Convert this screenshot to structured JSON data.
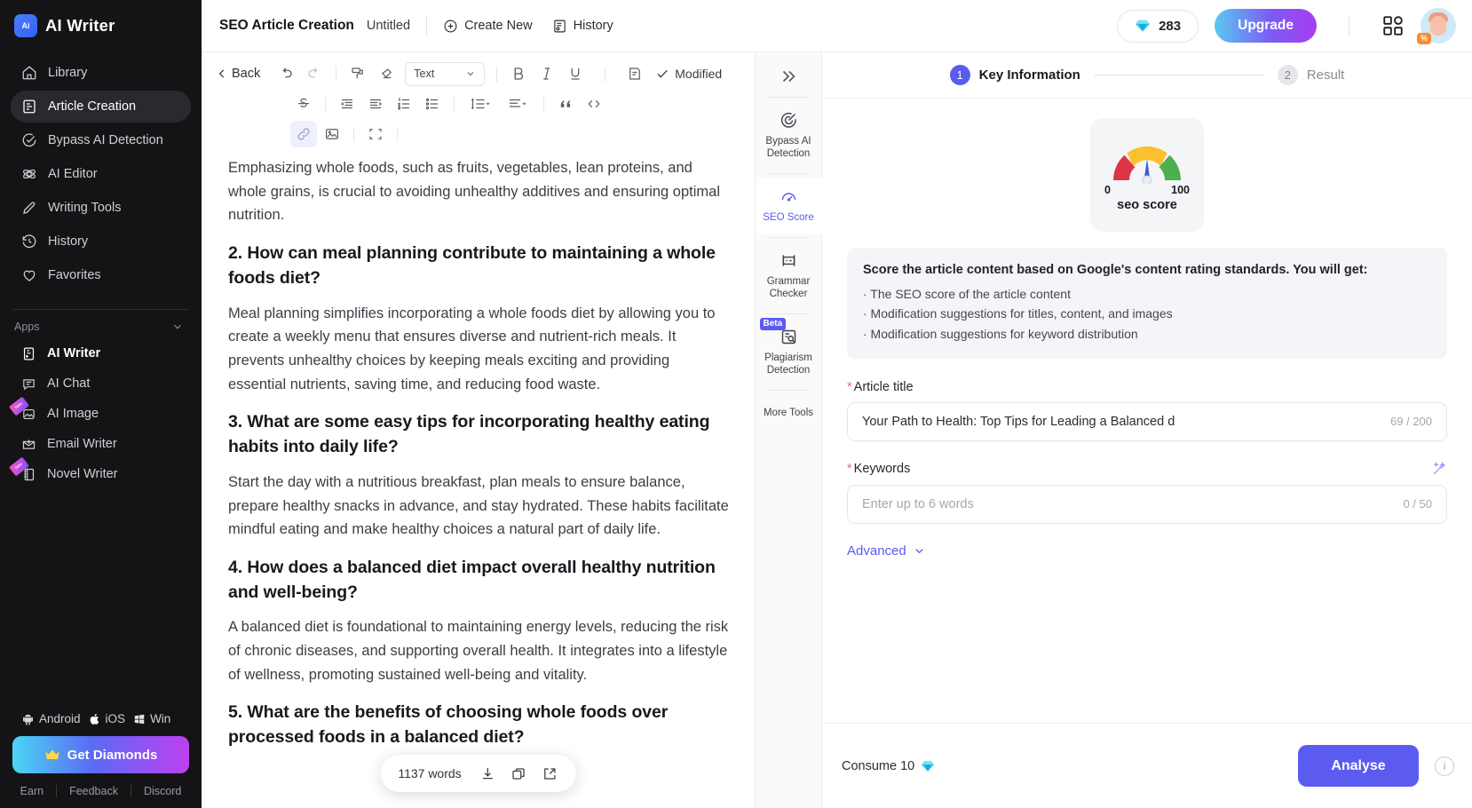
{
  "brand": {
    "name": "AI Writer",
    "logo_text": "Ai"
  },
  "sidebar": {
    "nav": [
      {
        "label": "Library",
        "icon": "home-icon"
      },
      {
        "label": "Article Creation",
        "icon": "document-icon"
      },
      {
        "label": "Bypass AI Detection",
        "icon": "check-circle-icon"
      },
      {
        "label": "AI Editor",
        "icon": "atom-icon"
      },
      {
        "label": "Writing Tools",
        "icon": "pencil-icon"
      },
      {
        "label": "History",
        "icon": "clock-icon"
      },
      {
        "label": "Favorites",
        "icon": "heart-icon"
      }
    ],
    "apps_header": "Apps",
    "apps": [
      {
        "label": "AI Writer",
        "icon": "book-icon",
        "ribbon": ""
      },
      {
        "label": "AI Chat",
        "icon": "chat-icon",
        "ribbon": ""
      },
      {
        "label": "AI Image",
        "icon": "image-icon",
        "ribbon": "New"
      },
      {
        "label": "Email Writer",
        "icon": "mail-icon",
        "ribbon": ""
      },
      {
        "label": "Novel Writer",
        "icon": "notebook-icon",
        "ribbon": "New"
      }
    ],
    "platforms": [
      "Android",
      "iOS",
      "Win"
    ],
    "get_diamonds": "Get Diamonds",
    "links": [
      "Earn",
      "Feedback",
      "Discord"
    ]
  },
  "topbar": {
    "title": "SEO Article Creation",
    "doc_name": "Untitled",
    "create_new": "Create New",
    "history": "History",
    "credits": "283",
    "upgrade": "Upgrade"
  },
  "editor": {
    "back": "Back",
    "style_select": "Text",
    "status": "Modified",
    "word_count": "1137 words",
    "blocks": [
      {
        "type": "p",
        "text": "Emphasizing whole foods, such as fruits, vegetables, lean proteins, and whole grains, is crucial to avoiding unhealthy additives and ensuring optimal nutrition."
      },
      {
        "type": "h3",
        "text": "2. How can meal planning contribute to maintaining a whole foods diet?"
      },
      {
        "type": "p",
        "text": "Meal planning simplifies incorporating a whole foods diet by allowing you to create a weekly menu that ensures diverse and nutrient-rich meals. It prevents unhealthy choices by keeping meals exciting and providing essential nutrients, saving time, and reducing food waste."
      },
      {
        "type": "h3",
        "text": "3. What are some easy tips for incorporating healthy eating habits into daily life?"
      },
      {
        "type": "p",
        "text": "Start the day with a nutritious breakfast, plan meals to ensure balance, prepare healthy snacks in advance, and stay hydrated. These habits facilitate mindful eating and make healthy choices a natural part of daily life."
      },
      {
        "type": "h3",
        "text": "4. How does a balanced diet impact overall healthy nutrition and well-being?"
      },
      {
        "type": "p",
        "text": "A balanced diet is foundational to maintaining energy levels, reducing the risk of chronic diseases, and supporting overall health. It integrates into a lifestyle of wellness, promoting sustained well-being and vitality."
      },
      {
        "type": "h3",
        "text": "5. What are the benefits of choosing whole foods over processed foods in a balanced diet?"
      }
    ]
  },
  "tools": [
    {
      "label": "Bypass AI Detection",
      "icon": "target-icon",
      "badge": ""
    },
    {
      "label": "SEO Score",
      "icon": "gauge-icon",
      "badge": ""
    },
    {
      "label": "Grammar Checker",
      "icon": "grammar-icon",
      "badge": ""
    },
    {
      "label": "Plagiarism Detection",
      "icon": "plagiarism-icon",
      "badge": "Beta"
    },
    {
      "label": "More Tools",
      "icon": "",
      "badge": ""
    }
  ],
  "panel": {
    "steps": [
      {
        "num": "1",
        "label": "Key Information"
      },
      {
        "num": "2",
        "label": "Result"
      }
    ],
    "gauge": {
      "min": "0",
      "max": "100",
      "caption": "seo score"
    },
    "info": {
      "heading": "Score the article content based on Google's content rating standards. You will get:",
      "bullets": [
        "· The SEO score of the article content",
        "· Modification suggestions for titles, content, and images",
        "· Modification suggestions for keyword distribution"
      ]
    },
    "article_title": {
      "label": "Article title",
      "value": "Your Path to Health: Top Tips for Leading a Balanced d",
      "counter": "69 / 200"
    },
    "keywords": {
      "label": "Keywords",
      "placeholder": "Enter up to 6 words",
      "counter": "0 / 50"
    },
    "advanced": "Advanced",
    "consume": "Consume 10",
    "analyse": "Analyse"
  },
  "colors": {
    "accent": "#5b5bf0",
    "sidebar_bg": "#141416",
    "gauge_red": "#dc3545",
    "gauge_yellow": "#fbc02d",
    "gauge_green": "#4caf50"
  }
}
